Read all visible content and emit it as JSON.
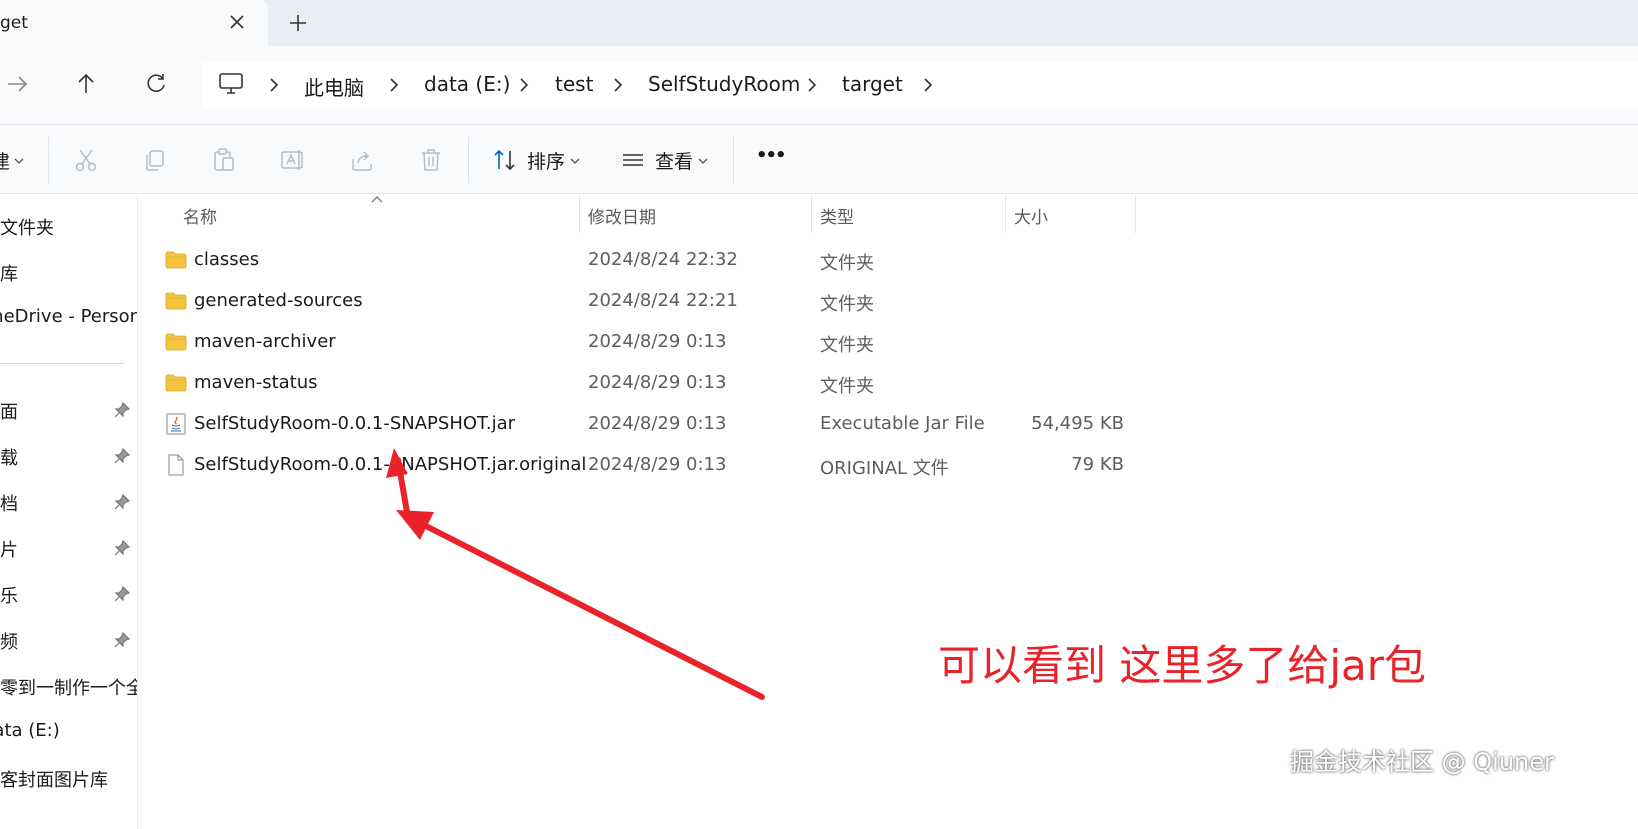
{
  "window": {
    "tab_title": "get",
    "tab_close_icon": "close-icon",
    "new_tab_icon": "plus-icon"
  },
  "nav": {
    "forward_icon": "arrow-right-icon",
    "up_icon": "arrow-up-icon",
    "refresh_icon": "refresh-icon",
    "pc_icon": "monitor-icon",
    "breadcrumbs": [
      "此电脑",
      "data (E:)",
      "test",
      "SelfStudyRoom",
      "target"
    ]
  },
  "toolbar": {
    "new_label": "建",
    "sort_label": "排序",
    "view_label": "查看",
    "more_label": "•••",
    "icons": [
      "cut-icon",
      "copy-icon",
      "paste-icon",
      "rename-icon",
      "share-icon",
      "delete-icon"
    ]
  },
  "sidebar": {
    "items": [
      {
        "label": "主文件夹",
        "pinned": false
      },
      {
        "label": "图库",
        "pinned": false
      },
      {
        "label": "OneDrive - Personal",
        "pinned": false
      },
      {
        "label": "桌面",
        "pinned": true
      },
      {
        "label": "下载",
        "pinned": true
      },
      {
        "label": "文档",
        "pinned": true
      },
      {
        "label": "图片",
        "pinned": true
      },
      {
        "label": "音乐",
        "pinned": true
      },
      {
        "label": "视频",
        "pinned": true
      },
      {
        "label": "从零到一制作一个全",
        "pinned": false
      },
      {
        "label": "data (E:)",
        "pinned": false
      },
      {
        "label": "博客封面图片库",
        "pinned": false
      }
    ]
  },
  "columns": {
    "name": "名称",
    "date": "修改日期",
    "type": "类型",
    "size": "大小"
  },
  "files": [
    {
      "name": "classes",
      "date": "2024/8/24 22:32",
      "type": "文件夹",
      "size": "",
      "icon": "folder-icon"
    },
    {
      "name": "generated-sources",
      "date": "2024/8/24 22:21",
      "type": "文件夹",
      "size": "",
      "icon": "folder-icon"
    },
    {
      "name": "maven-archiver",
      "date": "2024/8/29 0:13",
      "type": "文件夹",
      "size": "",
      "icon": "folder-icon"
    },
    {
      "name": "maven-status",
      "date": "2024/8/29 0:13",
      "type": "文件夹",
      "size": "",
      "icon": "folder-icon"
    },
    {
      "name": "SelfStudyRoom-0.0.1-SNAPSHOT.jar",
      "date": "2024/8/29 0:13",
      "type": "Executable Jar File",
      "size": "54,495 KB",
      "icon": "java-jar-icon"
    },
    {
      "name": "SelfStudyRoom-0.0.1-SNAPSHOT.jar.original",
      "date": "2024/8/29 0:13",
      "type": "ORIGINAL 文件",
      "size": "79 KB",
      "icon": "file-icon"
    }
  ],
  "annotation": {
    "text": "可以看到 这里多了给jar包",
    "color": "#e8232b"
  },
  "watermark": "掘金技术社区 @ Qiuner",
  "colors": {
    "folder": "#f5c542",
    "accent": "#0067c0"
  }
}
